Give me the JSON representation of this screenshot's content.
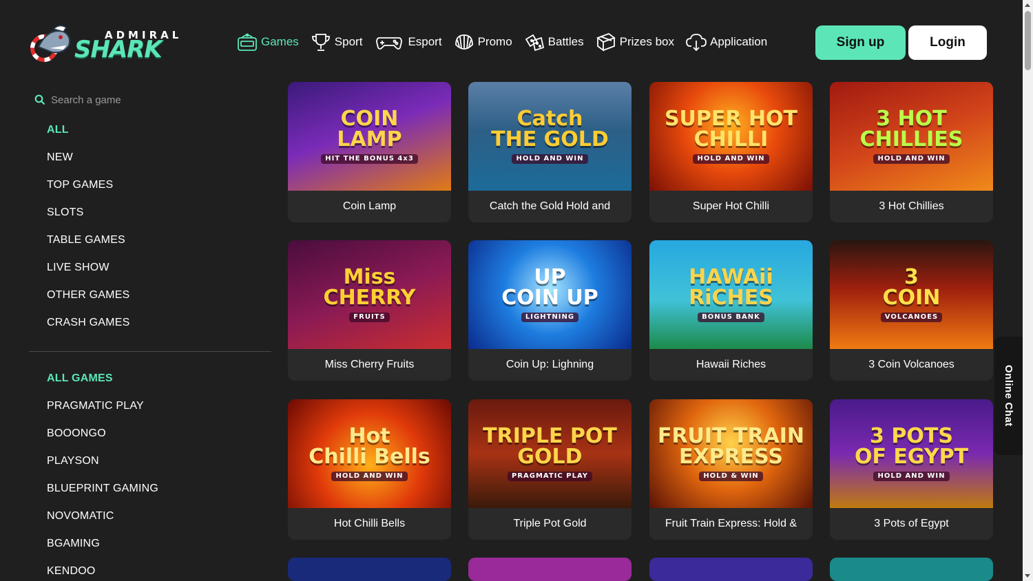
{
  "brand": {
    "top": "ADMIRAL",
    "main": "SHARK",
    "accent": "#5ce6b8"
  },
  "nav": [
    {
      "label": "Games",
      "icon": "slot-machine-icon",
      "active": true
    },
    {
      "label": "Sport",
      "icon": "trophy-icon"
    },
    {
      "label": "Esport",
      "icon": "gamepad-icon"
    },
    {
      "label": "Promo",
      "icon": "shell-icon"
    },
    {
      "label": "Battles",
      "icon": "dice-icon"
    },
    {
      "label": "Prizes box",
      "icon": "gift-box-icon"
    },
    {
      "label": "Application",
      "icon": "cloud-download-icon"
    }
  ],
  "auth": {
    "signup": "Sign up",
    "login": "Login"
  },
  "search": {
    "placeholder": "Search a game"
  },
  "categories": [
    "ALL",
    "NEW",
    "TOP GAMES",
    "SLOTS",
    "TABLE GAMES",
    "LIVE SHOW",
    "OTHER GAMES",
    "CRASH GAMES"
  ],
  "providers": [
    "ALL GAMES",
    "PRAGMATIC PLAY",
    "BOOONGO",
    "PLAYSON",
    "BLUEPRINT GAMING",
    "NOVOMATIC",
    "BGAMING",
    "KENDOO"
  ],
  "games": [
    {
      "name": "Coin Lamp",
      "art": [
        "COIN",
        "LAMP",
        "HIT THE BONUS 4x3"
      ],
      "bg": "linear-gradient(160deg,#3b1a7a 0%,#7a2bb8 45%,#e07b14 100%)",
      "fg": "#ffd54a"
    },
    {
      "name": "Catch the Gold Hold and",
      "art": [
        "Catch",
        "THE GOLD",
        "HOLD AND WIN"
      ],
      "bg": "linear-gradient(180deg,#5a7fa8 0%,#2d5f86 45%,#1c6b9a 100%)",
      "fg": "#ffcc33"
    },
    {
      "name": "Super Hot Chilli",
      "art": [
        "SUPER HOT",
        "CHILLI",
        "HOLD AND WIN"
      ],
      "bg": "radial-gradient(circle at 50% 40%,#ffb020 0%,#e84a0c 45%,#7a1005 100%)",
      "fg": "#ffe36a"
    },
    {
      "name": "3 Hot Chillies",
      "art": [
        "3 HOT",
        "CHILLIES",
        "HOLD AND WIN"
      ],
      "bg": "linear-gradient(160deg,#a11a10 0%,#d2441a 50%,#f08a1a 100%)",
      "fg": "#b9ff4a"
    },
    {
      "name": "Miss Cherry Fruits",
      "art": [
        "Miss",
        "CHERRY",
        "FRUITS"
      ],
      "bg": "linear-gradient(160deg,#4a0d3d 0%,#8a1a55 50%,#c92e2e 100%)",
      "fg": "#ffd033"
    },
    {
      "name": "Coin Up: Lighning",
      "art": [
        "UP",
        "COIN UP",
        "LIGHTNING"
      ],
      "bg": "radial-gradient(circle at 50% 45%,#a8e6ff 0%,#1e7de0 45%,#0a2b8c 100%)",
      "fg": "#ffffff"
    },
    {
      "name": "Hawaii Riches",
      "art": [
        "HAWAii",
        "RiCHES",
        "BONUS BANK"
      ],
      "bg": "linear-gradient(180deg,#27a8e0 0%,#40c2d8 55%,#1d8a4a 100%)",
      "fg": "#ffd44a"
    },
    {
      "name": "3 Coin Volcanoes",
      "art": [
        "3",
        "COIN",
        "VOLCANOES"
      ],
      "bg": "linear-gradient(180deg,#2a1610 0%,#a0200e 45%,#f07a12 100%)",
      "fg": "#ffe04a"
    },
    {
      "name": "Hot Chilli Bells",
      "art": [
        "Hot",
        "Chilli Bells",
        "HOLD AND WIN"
      ],
      "bg": "radial-gradient(circle at 50% 60%,#ffb01a 0%,#e03a0a 50%,#6a0a04 100%)",
      "fg": "#ffe98a"
    },
    {
      "name": "Triple Pot Gold",
      "art": [
        "TRIPLE POT",
        "GOLD",
        "PRAGMATIC PLAY"
      ],
      "bg": "linear-gradient(180deg,#6a1a0e 0%,#a83214 50%,#3a1a0a 100%)",
      "fg": "#ffd54a"
    },
    {
      "name": "Fruit Train Express: Hold &",
      "art": [
        "FRUIT TRAIN",
        "EXPRESS",
        "HOLD & WIN"
      ],
      "bg": "radial-gradient(circle at 50% 40%,#ffd24a 0%,#e0660e 45%,#5a1206 100%)",
      "fg": "#ffea8a"
    },
    {
      "name": "3 Pots of Egypt",
      "art": [
        "3 POTS",
        "OF EGYPT",
        "HOLD AND WIN"
      ],
      "bg": "linear-gradient(180deg,#4a1a8a 0%,#7a2ab0 50%,#c07a10 100%)",
      "fg": "#ffd84a"
    }
  ],
  "partial_row_bgs": [
    "#1a2a7a",
    "#9a2a9a",
    "#3a2a9a",
    "#1a8a8a"
  ],
  "chat": {
    "label": "Online Chat"
  }
}
